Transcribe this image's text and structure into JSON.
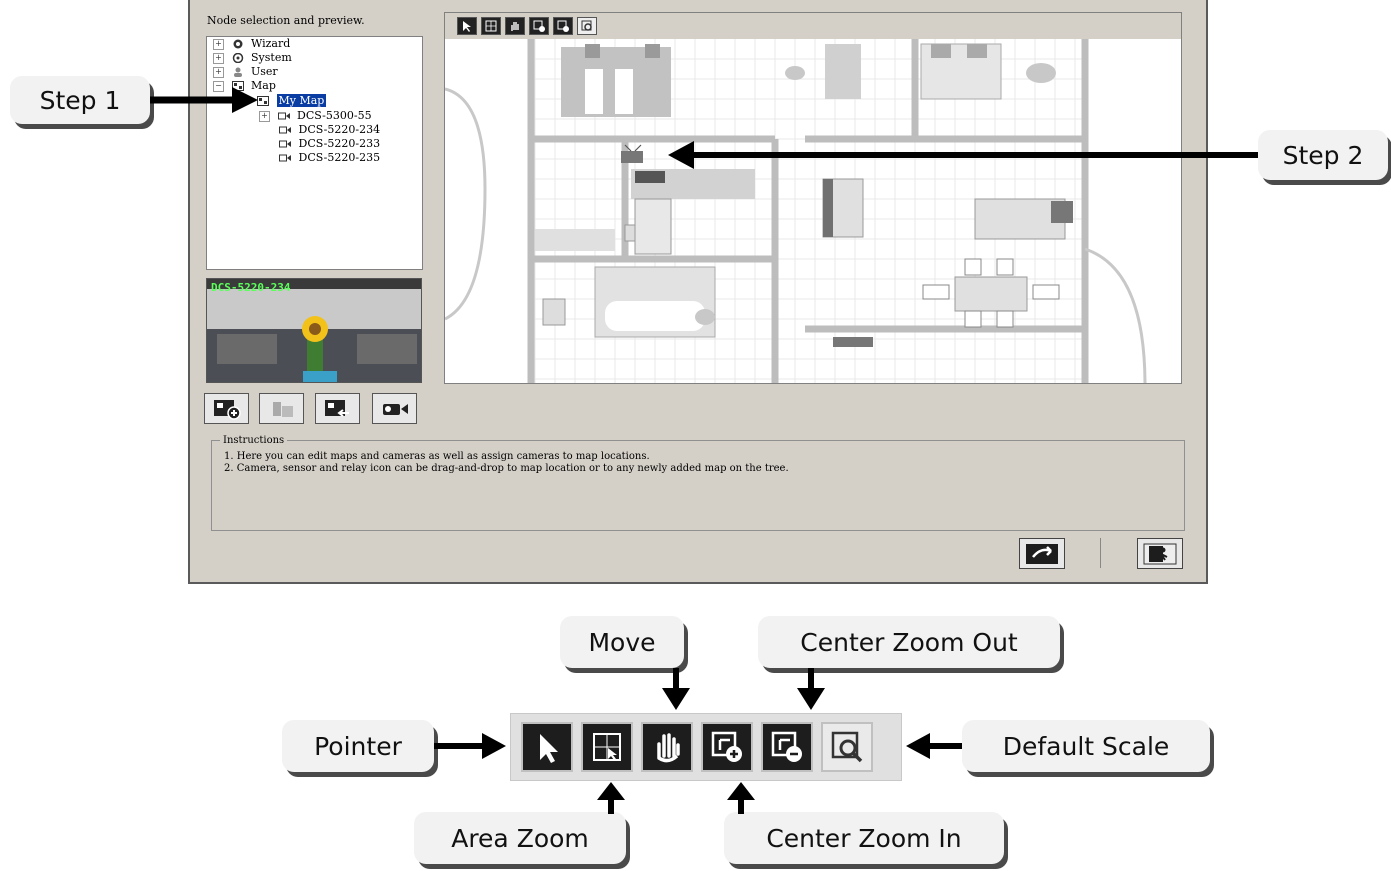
{
  "tree": {
    "heading": "Node selection and preview.",
    "items": [
      {
        "label": "Wizard",
        "expander": "+",
        "icon": "wizard-icon"
      },
      {
        "label": "System",
        "expander": "+",
        "icon": "system-icon"
      },
      {
        "label": "User",
        "expander": "+",
        "icon": "user-icon"
      },
      {
        "label": "Map",
        "expander": "−",
        "icon": "map-icon"
      },
      {
        "label": "My Map",
        "selected": true,
        "icon": "map-icon"
      },
      {
        "label": "DCS-5300-55",
        "expander": "+",
        "icon": "camera-icon"
      },
      {
        "label": "DCS-5220-234",
        "icon": "camera-icon"
      },
      {
        "label": "DCS-5220-233",
        "icon": "camera-icon"
      },
      {
        "label": "DCS-5220-235",
        "icon": "camera-icon"
      }
    ]
  },
  "preview": {
    "label": "DCS-5220-234"
  },
  "instructions": {
    "title": "Instructions",
    "lines": [
      "1. Here you can edit maps and cameras as well as assign cameras to map locations.",
      "2. Camera, sensor and relay icon can be drag-and-drop to map location or to any newly added map on the tree."
    ]
  },
  "callouts": {
    "step1": "Step 1",
    "step2": "Step 2",
    "move": "Move",
    "center_zoom_out": "Center Zoom Out",
    "pointer": "Pointer",
    "default_scale": "Default Scale",
    "area_zoom": "Area Zoom",
    "center_zoom_in": "Center Zoom In"
  },
  "map_tools": [
    "pointer-icon",
    "area-zoom-icon",
    "move-hand-icon",
    "center-zoom-in-icon",
    "center-zoom-out-icon",
    "default-scale-icon"
  ],
  "colors": {
    "selection": "#0a3da3",
    "window": "#d4d0c8",
    "callout": "#f2f2f2"
  }
}
